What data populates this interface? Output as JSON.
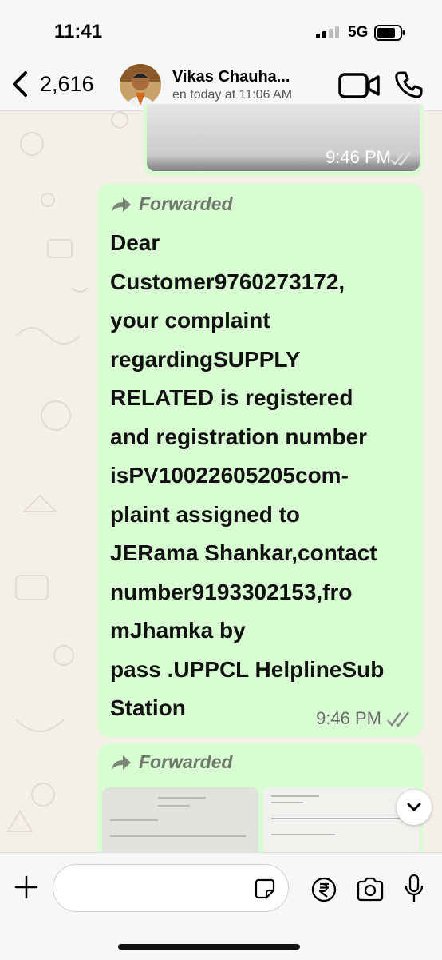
{
  "status_bar": {
    "time": "11:41",
    "network": "5G"
  },
  "header": {
    "back_count": "2,616",
    "contact_name": "Vikas Chauha...",
    "last_seen": "en today at 11:06 AM"
  },
  "messages": {
    "image_message_time": "9:46 PM",
    "text_message": {
      "forwarded_label": "Forwarded",
      "body": "Dear\nCustomer9760273172,\nyour complaint\nregardingSUPPLY\nRELATED is registered\nand registration number\nisPV10022605205com-\nplaint assigned to\nJERama Shankar,contact\nnumber9193302153,fro\nmJhamka by\npass .UPPCL HelplineSub\nStation",
      "time": "9:46 PM"
    },
    "bottom_message": {
      "forwarded_label": "Forwarded"
    }
  },
  "input_bar": {
    "placeholder": ""
  },
  "colors": {
    "bubble_green": "#d9fdd3",
    "chat_background": "#f4efe7",
    "read_ticks": "#8a8a8a"
  }
}
